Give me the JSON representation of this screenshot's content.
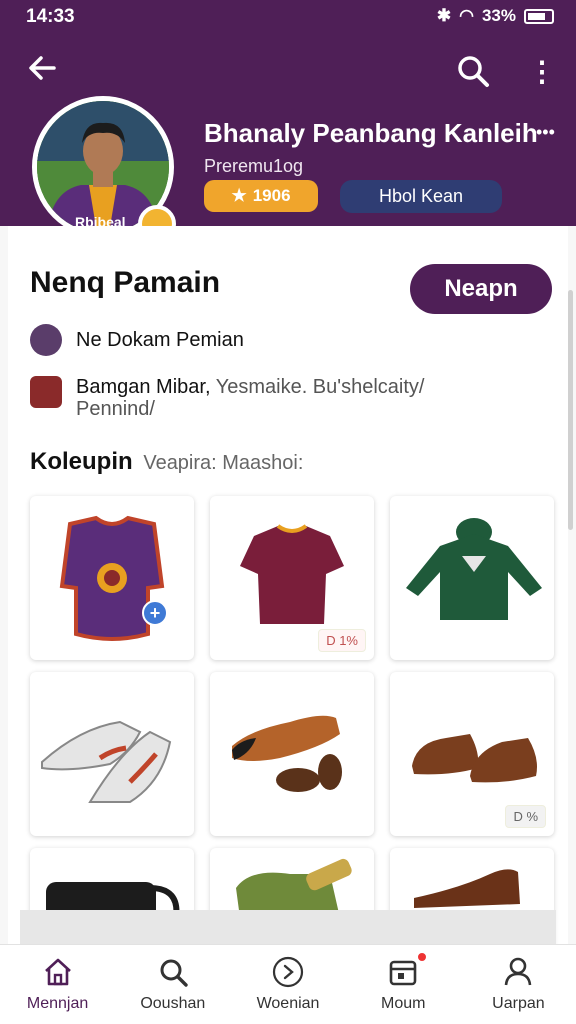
{
  "status_bar": {
    "time": "14:33",
    "battery": "33%"
  },
  "header": {
    "name": "Bhanaly Peanbang Kanleih",
    "dots": "•••",
    "subtitle": "Preremu1og",
    "rating": "1906",
    "follow_label": "Hbol Kean"
  },
  "section": {
    "title": "Nenq Pamain",
    "action_label": "Neapn"
  },
  "info": {
    "row1": "Ne Dokam Pemian",
    "row2_main": "Bamgan Mibar,",
    "row2_muted": "Yesmaike. Bu'shelcaity/",
    "row2_line2": "Pennind/"
  },
  "collection": {
    "title": "Koleupin",
    "subtitle": "Veapira: Maashoi:"
  },
  "items": [
    {
      "name": "purple-club-jersey",
      "color": "#5a2d7a"
    },
    {
      "name": "maroon-jersey",
      "color": "#7a1e3a",
      "price": "D 1%"
    },
    {
      "name": "green-hoodie",
      "color": "#1f5a3a"
    },
    {
      "name": "football-boots",
      "color": "#d9d9d9"
    },
    {
      "name": "brown-black-shoes",
      "color": "#b4632a"
    },
    {
      "name": "brown-leather-shoes",
      "color": "#7a3e1e",
      "price": "D %"
    },
    {
      "name": "black-bag",
      "color": "#1c1c1c"
    },
    {
      "name": "green-bag",
      "color": "#6f8a3a"
    },
    {
      "name": "brown-dress-shoe",
      "color": "#6a3218"
    }
  ],
  "nav": [
    {
      "label": "Mennjan",
      "icon": "home-icon"
    },
    {
      "label": "Ooushan",
      "icon": "search-icon"
    },
    {
      "label": "Woenian",
      "icon": "compass-icon"
    },
    {
      "label": "Moum",
      "icon": "inbox-icon"
    },
    {
      "label": "Uarpan",
      "icon": "profile-icon"
    }
  ],
  "colors": {
    "brand": "#4f1f57",
    "rating": "#f0a52c",
    "follow": "#2f3d73"
  }
}
